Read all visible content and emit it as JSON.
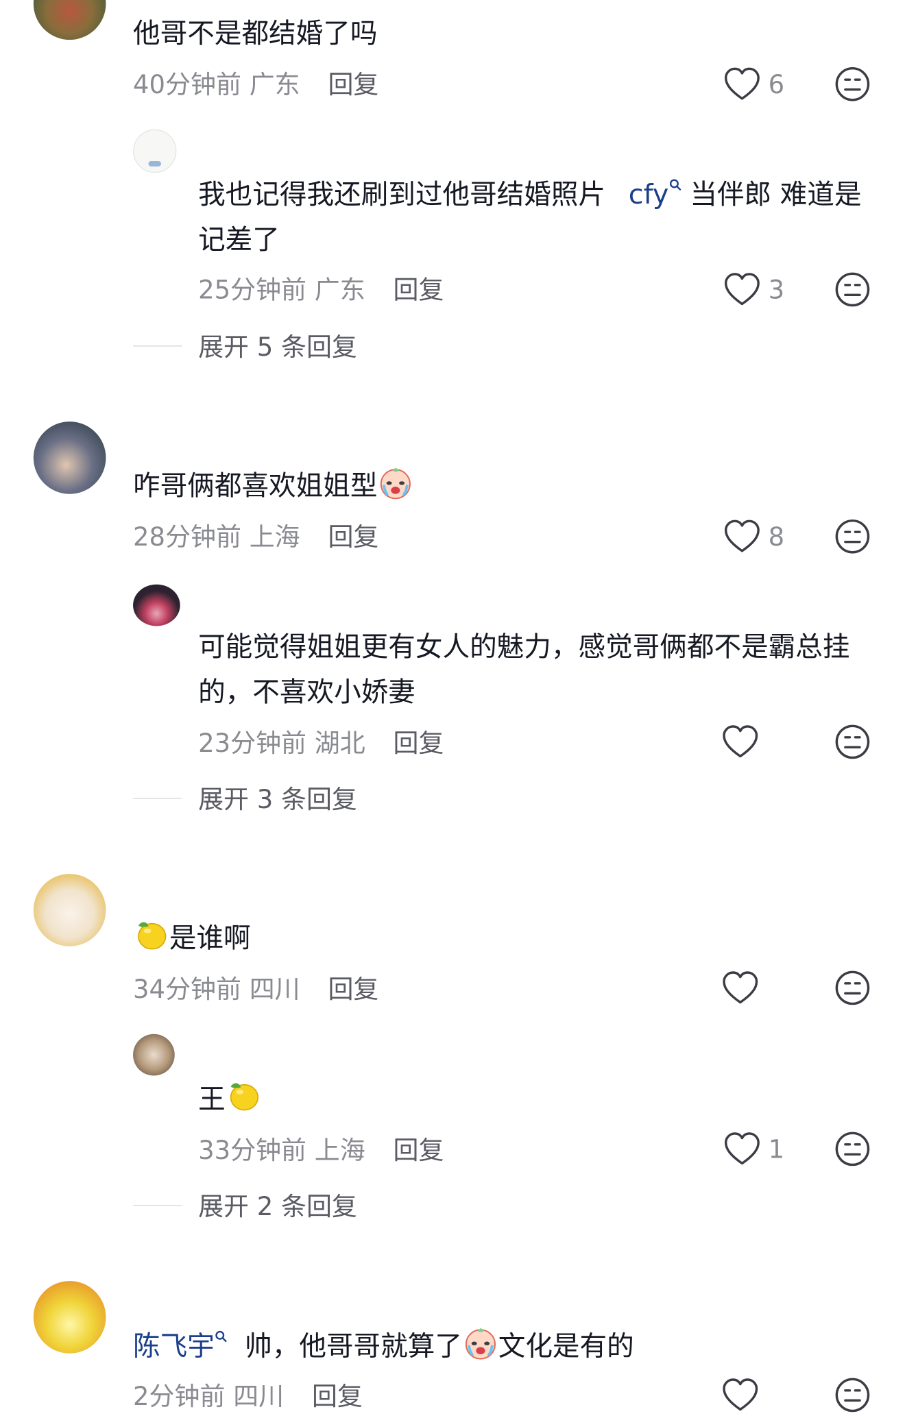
{
  "comments": [
    {
      "text": "他哥不是都结婚了吗",
      "time": "40分钟前",
      "location": "广东",
      "reply_label": "回复",
      "likes": "6",
      "replies": [
        {
          "text_before": "我也记得我还刷到过他哥结婚照片",
          "mention": "cfy",
          "text_after": "当伴郎 难道是记差了",
          "time": "25分钟前",
          "location": "广东",
          "reply_label": "回复",
          "likes": "3"
        }
      ],
      "expand_label": "展开 5 条回复"
    },
    {
      "text": "咋哥俩都喜欢姐姐型",
      "time": "28分钟前",
      "location": "上海",
      "reply_label": "回复",
      "likes": "8",
      "replies": [
        {
          "text": "可能觉得姐姐更有女人的魅力，感觉哥俩都不是霸总挂的，不喜欢小娇妻",
          "time": "23分钟前",
          "location": "湖北",
          "reply_label": "回复",
          "likes": ""
        }
      ],
      "expand_label": "展开 3 条回复"
    },
    {
      "text": "是谁啊",
      "time": "34分钟前",
      "location": "四川",
      "reply_label": "回复",
      "likes": "",
      "replies": [
        {
          "text": "王",
          "time": "33分钟前",
          "location": "上海",
          "reply_label": "回复",
          "likes": "1"
        }
      ],
      "expand_label": "展开 2 条回复"
    },
    {
      "mention": "陈飞宇",
      "text": "帅，他哥哥就算了",
      "text_after": "文化是有的",
      "time": "2分钟前",
      "location": "四川",
      "reply_label": "回复",
      "likes": ""
    }
  ],
  "icons": {
    "like": "heart-outline-icon",
    "dislike": "neutral-face-icon",
    "mention": "search-icon",
    "emoji_cry": "crying-face-emoji",
    "emoji_lemon": "lemon-emoji"
  },
  "colors": {
    "text": "#161823",
    "meta": "#8a8b91",
    "mention": "#1c3f8c"
  }
}
